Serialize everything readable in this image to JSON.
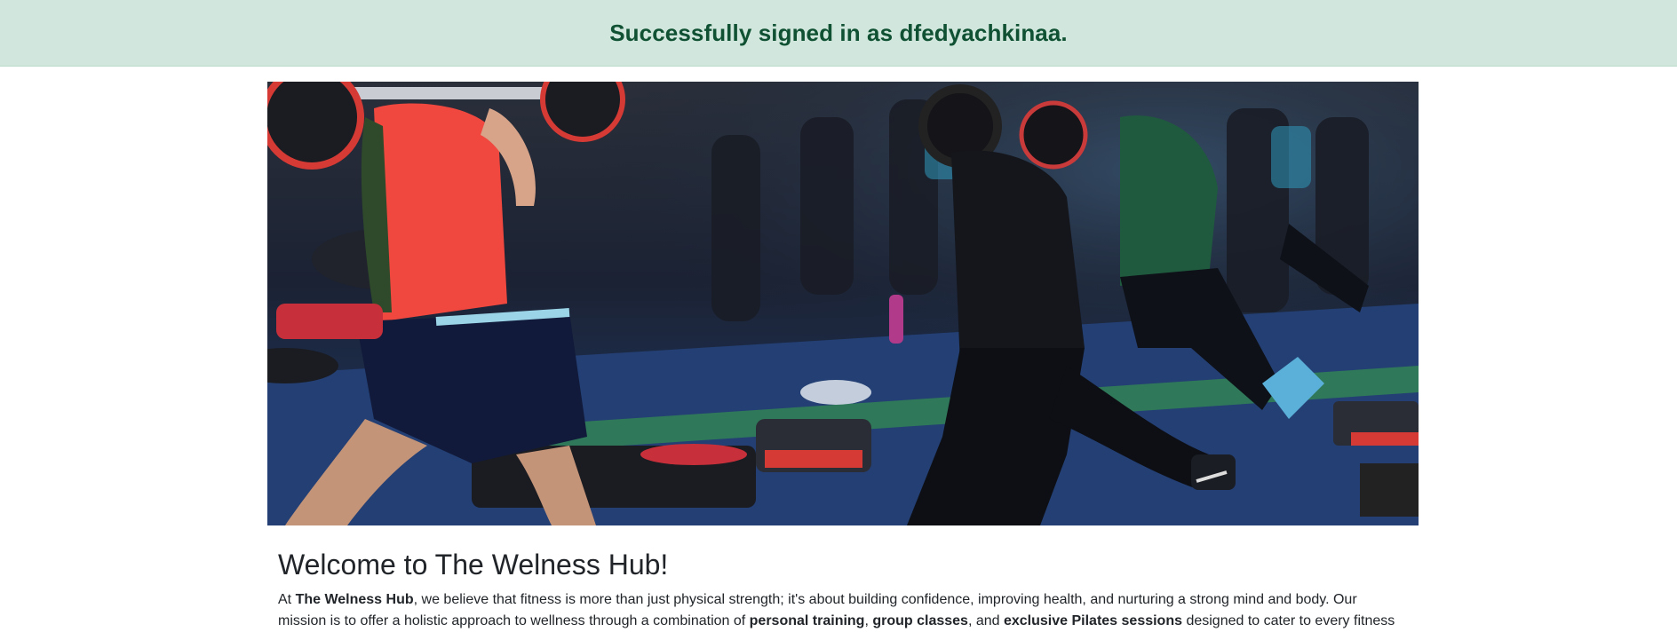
{
  "alert": {
    "message": "Successfully signed in as dfedyachkinaa."
  },
  "hero": {
    "image_icon": "fitness-class-photo",
    "colors": {
      "floor": "#1f3a6b",
      "tank_red": "#f0473e",
      "shorts_navy": "#111a3a",
      "green_stripe": "#3aa845",
      "dark": "#14161c"
    }
  },
  "welcome": {
    "title": "Welcome to The Welness Hub!",
    "intro_prefix": "At ",
    "brand": "The Welness Hub",
    "intro_line1_rest": ", we believe that fitness is more than just physical strength; it's about building confidence, improving health, and nurturing a strong mind and body. Our",
    "line2_start": "mission is to offer a holistic approach to wellness through a combination of ",
    "personal_training": "personal training",
    "comma1": ", ",
    "group_classes": "group classes",
    "and_text": ", and ",
    "pilates": "exclusive Pilates sessions",
    "line2_end": " designed to cater to every fitness"
  }
}
